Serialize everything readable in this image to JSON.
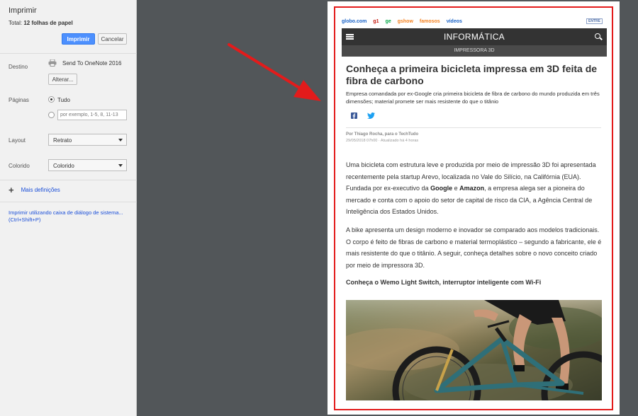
{
  "print_panel": {
    "title": "Imprimir",
    "total_prefix": "Total:",
    "total_value": "12 folhas de papel",
    "print_button": "Imprimir",
    "cancel_button": "Cancelar",
    "destination": {
      "label": "Destino",
      "printer": "Send To OneNote 2016",
      "change_button": "Alterar..."
    },
    "pages": {
      "label": "Páginas",
      "all_option": "Tudo",
      "custom_placeholder": "por exemplo, 1-5, 8, 11-13"
    },
    "layout": {
      "label": "Layout",
      "value": "Retrato"
    },
    "color": {
      "label": "Colorido",
      "value": "Colorido"
    },
    "more_settings": "Mais definições",
    "system_dialog_link": "Imprimir utilizando caixa de diálogo de sistema... (Ctrl+Shift+P)"
  },
  "preview": {
    "portal_links": [
      {
        "label": "globo.com",
        "color": "#1b64c8"
      },
      {
        "label": "g1",
        "color": "#c4170c"
      },
      {
        "label": "ge",
        "color": "#06aa48"
      },
      {
        "label": "gshow",
        "color": "#f58220"
      },
      {
        "label": "famosos",
        "color": "#f58220"
      },
      {
        "label": "vídeos",
        "color": "#1b64c8"
      }
    ],
    "login_link": "ENTRE",
    "section_title": "INFORMÁTICA",
    "sub_section": "IMPRESSORA 3D",
    "headline": "Conheça a primeira bicicleta impressa em 3D feita de fibra de carbono",
    "lede": "Empresa comandada por ex-Google cria primeira bicicleta de fibra de carbono do mundo produzida em três dimensões; material promete ser mais resistente do que o titânio",
    "byline": "Por Thiago Rocha, para o TechTudo",
    "dateline": "29/05/2018 07h00 · Atualizado há 4 horas",
    "para1": {
      "a": "Uma bicicleta com estrutura leve e produzida por meio de impressão 3D foi apresentada recentemente pela startup Arevo, localizada no Vale do Silício, na Califórnia (EUA). Fundada por ex-executivo da ",
      "google": "Google",
      "b": " e ",
      "amazon": "Amazon",
      "c": ", a empresa alega ser a pioneira do mercado e conta com o apoio do setor de capital de risco da CIA, a Agência Central de Inteligência dos Estados Unidos."
    },
    "para2": "A bike apresenta um design moderno e inovador se comparado aos modelos tradicionais. O corpo é feito de fibras de carbono e material termoplástico – segundo a fabricante, ele é mais resistente do que o titânio. A seguir, conheça detalhes sobre o novo conceito criado por meio de impressora 3D.",
    "subhead": "Conheça o Wemo Light Switch, interruptor inteligente com Wi-Fi"
  },
  "colors": {
    "accent_blue": "#4d90fe",
    "highlight_red": "#e31b1b",
    "header_dark": "#333333",
    "facebook": "#3b5998",
    "twitter": "#1da1f2"
  }
}
